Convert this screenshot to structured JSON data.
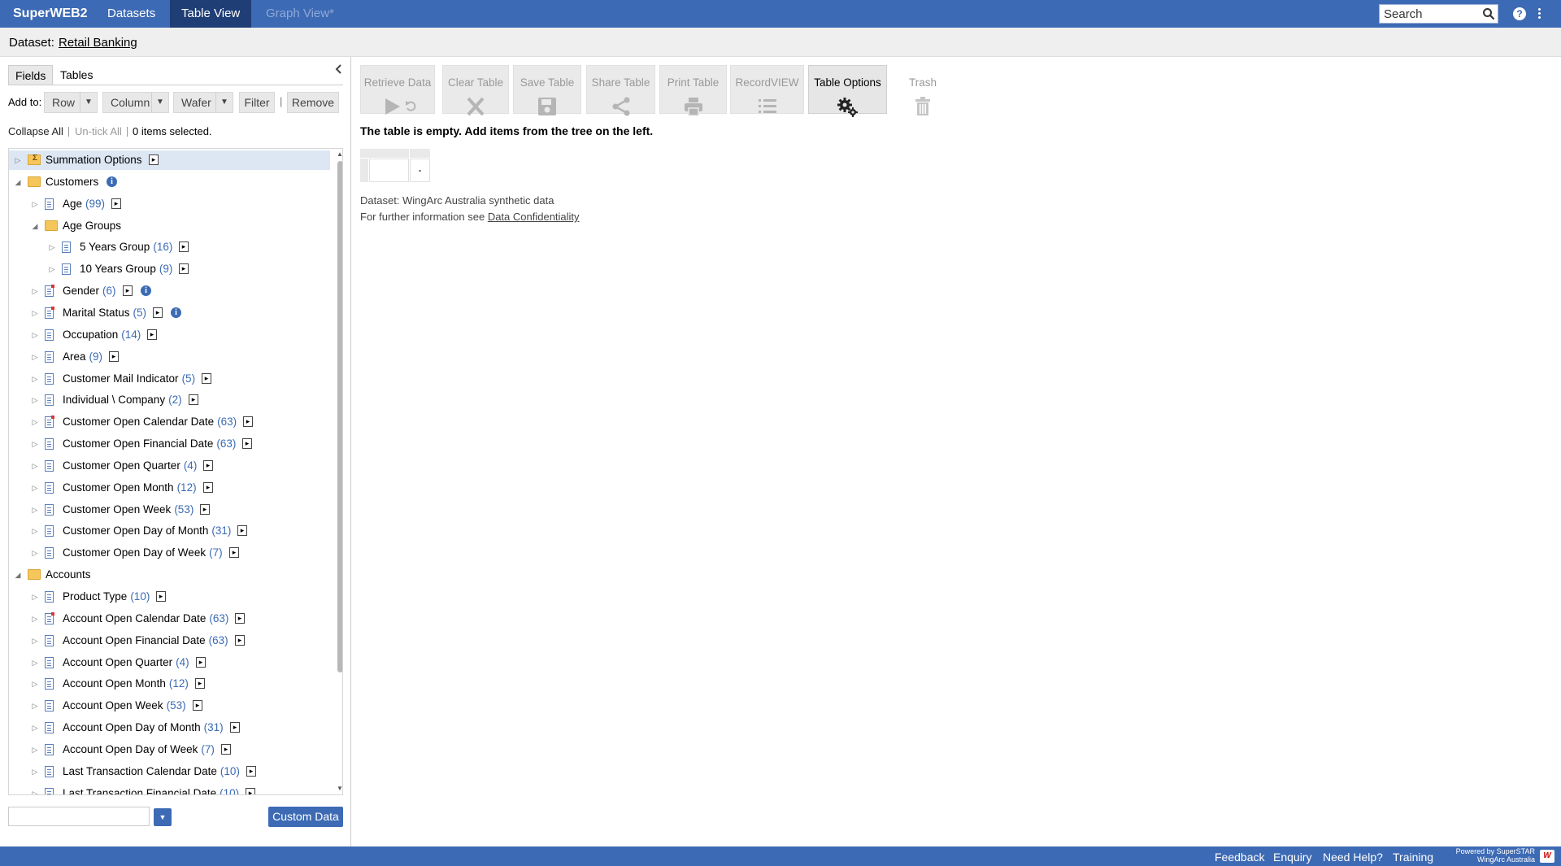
{
  "nav": {
    "brand": "SuperWEB2",
    "tabs": [
      {
        "label": "Datasets"
      },
      {
        "label": "Table View"
      },
      {
        "label": "Graph View*"
      }
    ],
    "search": {
      "placeholder": "Search",
      "value": ""
    }
  },
  "dataset": {
    "label": "Dataset:",
    "name": "Retail Banking"
  },
  "panel": {
    "tabs": [
      {
        "label": "Fields"
      },
      {
        "label": "Tables"
      }
    ],
    "add_to_label": "Add to:",
    "row_label": "Row",
    "column_label": "Column",
    "wafer_label": "Wafer",
    "filter_label": "Filter",
    "remove_label": "Remove",
    "separator": "|",
    "collapse_all": "Collapse All",
    "untick_all": "Un-tick All",
    "selected_count": "0 items selected."
  },
  "tree": [
    {
      "label": "Summation Options",
      "count": "",
      "level": 0,
      "icon": "summation-folder",
      "expand": "collapsed",
      "arrow": true,
      "info": false,
      "selected": true
    },
    {
      "label": "Customers",
      "count": "",
      "level": 0,
      "icon": "folder",
      "expand": "expanded",
      "arrow": false,
      "info": true
    },
    {
      "label": "Age",
      "count": "(99)",
      "level": 1,
      "icon": "field",
      "expand": "collapsed",
      "arrow": true,
      "info": false
    },
    {
      "label": "Age Groups",
      "count": "",
      "level": 1,
      "icon": "folder",
      "expand": "expanded",
      "arrow": false,
      "info": false
    },
    {
      "label": "5 Years Group",
      "count": "(16)",
      "level": 2,
      "icon": "field",
      "expand": "collapsed",
      "arrow": true,
      "info": false
    },
    {
      "label": "10 Years Group",
      "count": "(9)",
      "level": 2,
      "icon": "field",
      "expand": "collapsed",
      "arrow": true,
      "info": false
    },
    {
      "label": "Gender",
      "count": "(6)",
      "level": 1,
      "icon": "field-red",
      "expand": "collapsed",
      "arrow": true,
      "info": true
    },
    {
      "label": "Marital Status",
      "count": "(5)",
      "level": 1,
      "icon": "field-red",
      "expand": "collapsed",
      "arrow": true,
      "info": true
    },
    {
      "label": "Occupation",
      "count": "(14)",
      "level": 1,
      "icon": "field",
      "expand": "collapsed",
      "arrow": true,
      "info": false
    },
    {
      "label": "Area",
      "count": "(9)",
      "level": 1,
      "icon": "field",
      "expand": "collapsed",
      "arrow": true,
      "info": false
    },
    {
      "label": "Customer Mail Indicator",
      "count": "(5)",
      "level": 1,
      "icon": "field",
      "expand": "collapsed",
      "arrow": true,
      "info": false
    },
    {
      "label": "Individual \\ Company",
      "count": "(2)",
      "level": 1,
      "icon": "field",
      "expand": "collapsed",
      "arrow": true,
      "info": false
    },
    {
      "label": "Customer Open Calendar Date",
      "count": "(63)",
      "level": 1,
      "icon": "field-red",
      "expand": "collapsed",
      "arrow": true,
      "info": false
    },
    {
      "label": "Customer Open Financial Date",
      "count": "(63)",
      "level": 1,
      "icon": "field",
      "expand": "collapsed",
      "arrow": true,
      "info": false
    },
    {
      "label": "Customer Open Quarter",
      "count": "(4)",
      "level": 1,
      "icon": "field",
      "expand": "collapsed",
      "arrow": true,
      "info": false
    },
    {
      "label": "Customer Open Month",
      "count": "(12)",
      "level": 1,
      "icon": "field",
      "expand": "collapsed",
      "arrow": true,
      "info": false
    },
    {
      "label": "Customer Open Week",
      "count": "(53)",
      "level": 1,
      "icon": "field",
      "expand": "collapsed",
      "arrow": true,
      "info": false
    },
    {
      "label": "Customer Open Day of Month",
      "count": "(31)",
      "level": 1,
      "icon": "field",
      "expand": "collapsed",
      "arrow": true,
      "info": false
    },
    {
      "label": "Customer Open Day of Week",
      "count": "(7)",
      "level": 1,
      "icon": "field",
      "expand": "collapsed",
      "arrow": true,
      "info": false
    },
    {
      "label": "Accounts",
      "count": "",
      "level": 0,
      "icon": "folder",
      "expand": "expanded",
      "arrow": false,
      "info": false
    },
    {
      "label": "Product Type",
      "count": "(10)",
      "level": 1,
      "icon": "field",
      "expand": "collapsed",
      "arrow": true,
      "info": false
    },
    {
      "label": "Account Open Calendar Date",
      "count": "(63)",
      "level": 1,
      "icon": "field-red",
      "expand": "collapsed",
      "arrow": true,
      "info": false
    },
    {
      "label": "Account Open Financial Date",
      "count": "(63)",
      "level": 1,
      "icon": "field",
      "expand": "collapsed",
      "arrow": true,
      "info": false
    },
    {
      "label": "Account Open Quarter",
      "count": "(4)",
      "level": 1,
      "icon": "field",
      "expand": "collapsed",
      "arrow": true,
      "info": false
    },
    {
      "label": "Account Open Month",
      "count": "(12)",
      "level": 1,
      "icon": "field",
      "expand": "collapsed",
      "arrow": true,
      "info": false
    },
    {
      "label": "Account Open Week",
      "count": "(53)",
      "level": 1,
      "icon": "field",
      "expand": "collapsed",
      "arrow": true,
      "info": false
    },
    {
      "label": "Account Open Day of Month",
      "count": "(31)",
      "level": 1,
      "icon": "field",
      "expand": "collapsed",
      "arrow": true,
      "info": false
    },
    {
      "label": "Account Open Day of Week",
      "count": "(7)",
      "level": 1,
      "icon": "field",
      "expand": "collapsed",
      "arrow": true,
      "info": false
    },
    {
      "label": "Last Transaction Calendar Date",
      "count": "(10)",
      "level": 1,
      "icon": "field",
      "expand": "collapsed",
      "arrow": true,
      "info": false
    },
    {
      "label": "Last Transaction Financial Date",
      "count": "(10)",
      "level": 1,
      "icon": "field",
      "expand": "collapsed",
      "arrow": true,
      "info": false
    }
  ],
  "bottom": {
    "input_value": "",
    "custom_data_label": "Custom Data"
  },
  "toolbar": {
    "retrieve": "Retrieve Data",
    "clear": "Clear Table",
    "save": "Save Table",
    "share": "Share Table",
    "print": "Print Table",
    "recordview": "RecordVIEW",
    "options": "Table Options",
    "trash": "Trash"
  },
  "main": {
    "empty_message": "The table is empty. Add items from the tree on the left.",
    "empty_cell": "-",
    "dataset_info": "Dataset: WingArc Australia synthetic data",
    "confidentiality_prefix": "For further information see",
    "confidentiality_link": "Data Confidentiality"
  },
  "footer": {
    "links": [
      "Feedback",
      "Enquiry",
      "Need Help?",
      "Training"
    ],
    "powered_line1": "Powered by SuperSTAR",
    "powered_line2": "WingArc Australia"
  },
  "colors": {
    "accent": "#3d6ab4",
    "active_tab": "#1f3e75",
    "count_text": "#3b6bb3"
  }
}
